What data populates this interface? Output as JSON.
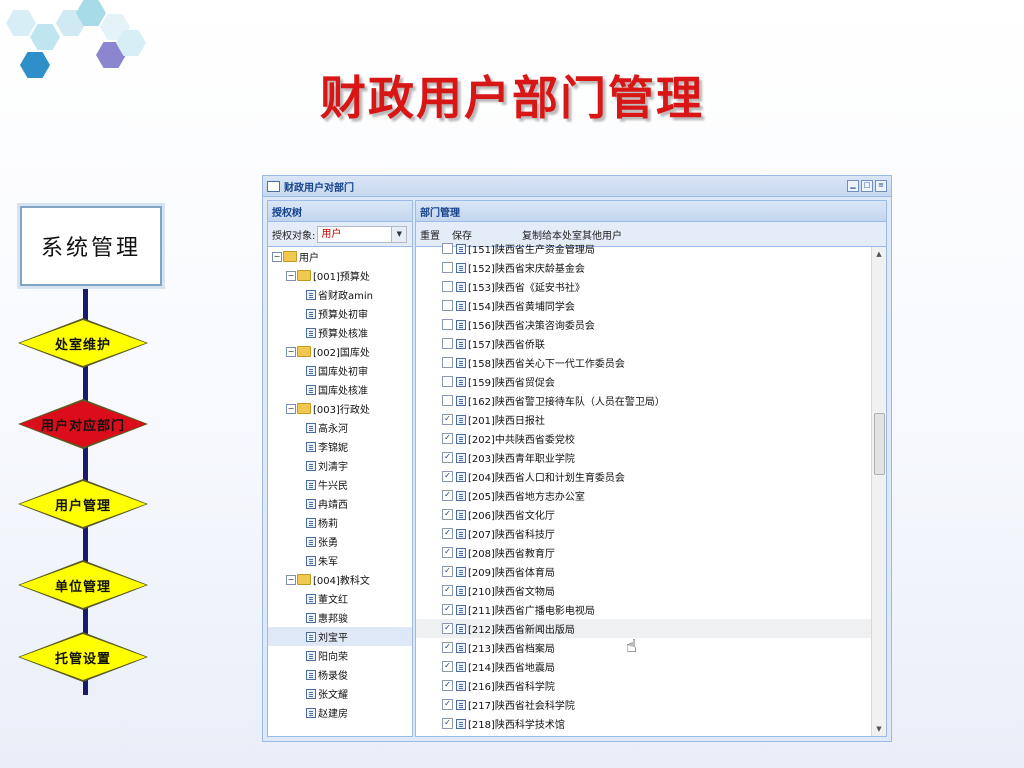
{
  "slide": {
    "title": "财政用户部门管理"
  },
  "flow": {
    "system_box": "系统管理",
    "steps": [
      {
        "label": "处室维护",
        "active": false
      },
      {
        "label": "用户对应部门",
        "active": true
      },
      {
        "label": "用户管理",
        "active": false
      },
      {
        "label": "单位管理",
        "active": false
      },
      {
        "label": "托管设置",
        "active": false
      }
    ]
  },
  "window": {
    "title": "财政用户对部门",
    "left_panel": {
      "title": "授权树",
      "filter_label": "授权对象:",
      "filter_value": "用户",
      "tree": [
        {
          "label": "用户",
          "level": 0,
          "type": "folder"
        },
        {
          "label": "[001]预算处",
          "level": 1,
          "type": "folder"
        },
        {
          "label": "省财政amin",
          "level": 2,
          "type": "leaf"
        },
        {
          "label": "预算处初审",
          "level": 2,
          "type": "leaf"
        },
        {
          "label": "预算处核准",
          "level": 2,
          "type": "leaf"
        },
        {
          "label": "[002]国库处",
          "level": 1,
          "type": "folder"
        },
        {
          "label": "国库处初审",
          "level": 2,
          "type": "leaf"
        },
        {
          "label": "国库处核准",
          "level": 2,
          "type": "leaf"
        },
        {
          "label": "[003]行政处",
          "level": 1,
          "type": "folder"
        },
        {
          "label": "高永河",
          "level": 2,
          "type": "leaf"
        },
        {
          "label": "李锦妮",
          "level": 2,
          "type": "leaf"
        },
        {
          "label": "刘清宇",
          "level": 2,
          "type": "leaf"
        },
        {
          "label": "牛兴民",
          "level": 2,
          "type": "leaf"
        },
        {
          "label": "冉靖西",
          "level": 2,
          "type": "leaf"
        },
        {
          "label": "杨莉",
          "level": 2,
          "type": "leaf"
        },
        {
          "label": "张勇",
          "level": 2,
          "type": "leaf"
        },
        {
          "label": "朱军",
          "level": 2,
          "type": "leaf"
        },
        {
          "label": "[004]教科文",
          "level": 1,
          "type": "folder"
        },
        {
          "label": "董文红",
          "level": 2,
          "type": "leaf"
        },
        {
          "label": "惠邦骏",
          "level": 2,
          "type": "leaf"
        },
        {
          "label": "刘宝平",
          "level": 2,
          "type": "leaf",
          "selected": true
        },
        {
          "label": "阳向荣",
          "level": 2,
          "type": "leaf"
        },
        {
          "label": "杨录俊",
          "level": 2,
          "type": "leaf"
        },
        {
          "label": "张文耀",
          "level": 2,
          "type": "leaf"
        },
        {
          "label": "赵建房",
          "level": 2,
          "type": "leaf"
        }
      ]
    },
    "right_panel": {
      "title": "部门管理",
      "toolbar": {
        "reset": "重置",
        "save": "保存",
        "copy": "复制给本处室其他用户"
      },
      "departments": [
        {
          "label": "[151]陕西省生产资金管理局",
          "checked": false
        },
        {
          "label": "[152]陕西省宋庆龄基金会",
          "checked": false
        },
        {
          "label": "[153]陕西省《延安书社》",
          "checked": false
        },
        {
          "label": "[154]陕西省黄埔同学会",
          "checked": false
        },
        {
          "label": "[156]陕西省决策咨询委员会",
          "checked": false
        },
        {
          "label": "[157]陕西省侨联",
          "checked": false
        },
        {
          "label": "[158]陕西省关心下一代工作委员会",
          "checked": false
        },
        {
          "label": "[159]陕西省贸促会",
          "checked": false
        },
        {
          "label": "[162]陕西省警卫接待车队（人员在警卫局）",
          "checked": false
        },
        {
          "label": "[201]陕西日报社",
          "checked": true
        },
        {
          "label": "[202]中共陕西省委党校",
          "checked": true
        },
        {
          "label": "[203]陕西青年职业学院",
          "checked": true
        },
        {
          "label": "[204]陕西省人口和计划生育委员会",
          "checked": true
        },
        {
          "label": "[205]陕西省地方志办公室",
          "checked": true
        },
        {
          "label": "[206]陕西省文化厅",
          "checked": true
        },
        {
          "label": "[207]陕西省科技厅",
          "checked": true
        },
        {
          "label": "[208]陕西省教育厅",
          "checked": true
        },
        {
          "label": "[209]陕西省体育局",
          "checked": true
        },
        {
          "label": "[210]陕西省文物局",
          "checked": true
        },
        {
          "label": "[211]陕西省广播电影电视局",
          "checked": true
        },
        {
          "label": "[212]陕西省新闻出版局",
          "checked": true,
          "hover": true
        },
        {
          "label": "[213]陕西省档案局",
          "checked": true
        },
        {
          "label": "[214]陕西省地震局",
          "checked": true
        },
        {
          "label": "[216]陕西省科学院",
          "checked": true
        },
        {
          "label": "[217]陕西省社会科学院",
          "checked": true
        },
        {
          "label": "[218]陕西科学技术馆",
          "checked": true
        }
      ]
    }
  },
  "colors": {
    "title_red": "#d91616",
    "diamond_yellow": "#ffff00",
    "diamond_active": "#dc0d1a",
    "panel_blue": "#15428b"
  }
}
